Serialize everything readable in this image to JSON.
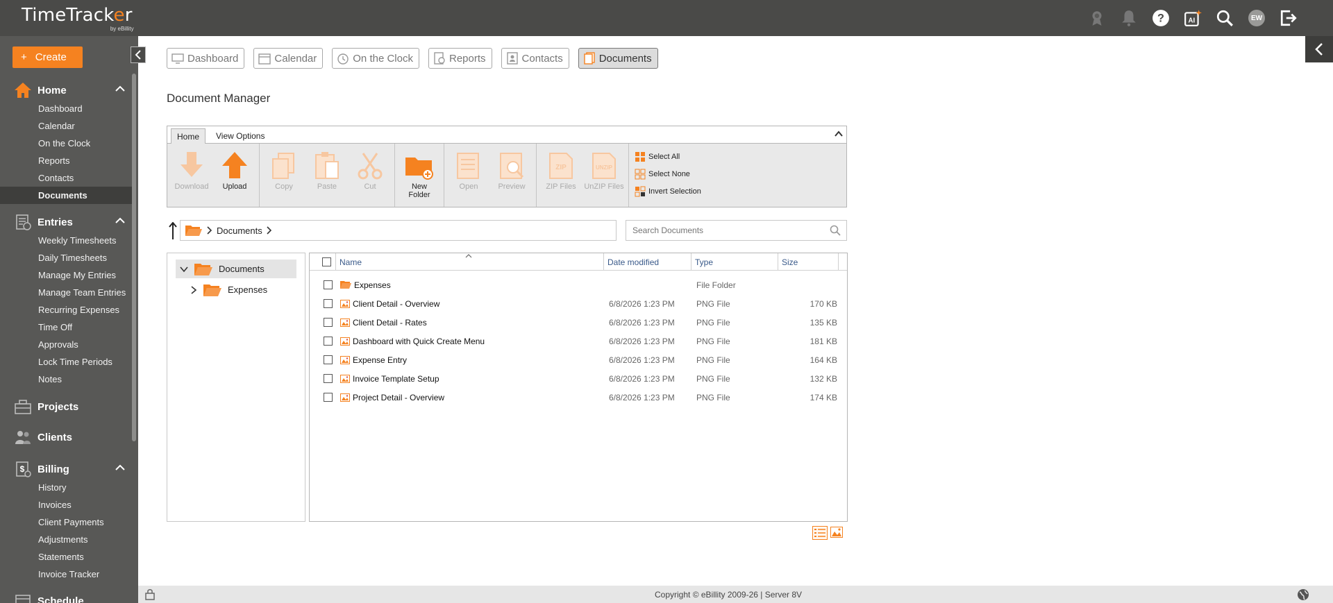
{
  "app": {
    "name": "TimeTrack",
    "name_o": "e",
    "name_end": "r",
    "sub": "by eBillity"
  },
  "topbar": {
    "avatar_initials": "EW",
    "icons": [
      "achievement-icon",
      "bell-icon",
      "help-icon",
      "ai-icon",
      "search-icon",
      "avatar",
      "logout-icon"
    ]
  },
  "sidebar": {
    "create_label": "Create",
    "sections": [
      {
        "title": "Home",
        "items": [
          "Dashboard",
          "Calendar",
          "On the Clock",
          "Reports",
          "Contacts",
          "Documents"
        ]
      },
      {
        "title": "Entries",
        "items": [
          "Weekly Timesheets",
          "Daily Timesheets",
          "Manage My Entries",
          "Manage Team Entries",
          "Recurring Expenses",
          "Time Off",
          "Approvals",
          "Lock Time Periods",
          "Notes"
        ]
      },
      {
        "title": "Projects",
        "items": []
      },
      {
        "title": "Clients",
        "items": []
      },
      {
        "title": "Billing",
        "items": [
          "History",
          "Invoices",
          "Client Payments",
          "Adjustments",
          "Statements",
          "Invoice Tracker"
        ]
      },
      {
        "title": "Schedule",
        "items": []
      }
    ],
    "active_item": "Documents"
  },
  "quick_tabs": [
    "Dashboard",
    "Calendar",
    "On the Clock",
    "Reports",
    "Contacts",
    "Documents"
  ],
  "page_title": "Document Manager",
  "ribbon": {
    "tabs": [
      "Home",
      "View Options"
    ],
    "buttons": {
      "download": "Download",
      "upload": "Upload",
      "copy": "Copy",
      "paste": "Paste",
      "cut": "Cut",
      "new_folder_1": "New",
      "new_folder_2": "Folder",
      "open": "Open",
      "preview": "Preview",
      "zip": "ZIP Files",
      "unzip": "UnZIP Files",
      "zip_glyph": "ZIP",
      "unzip_glyph": "UNZIP"
    },
    "selection": [
      "Select All",
      "Select None",
      "Invert Selection"
    ]
  },
  "path": {
    "current": "Documents"
  },
  "search": {
    "placeholder": "Search Documents"
  },
  "tree": {
    "root": "Documents",
    "child": "Expenses"
  },
  "files": {
    "columns": {
      "name": "Name",
      "date": "Date modified",
      "type": "Type",
      "size": "Size"
    },
    "rows": [
      {
        "name": "Expenses",
        "date": "",
        "type": "File Folder",
        "size": ""
      },
      {
        "name": "Client Detail - Overview",
        "date": "6/8/2026 1:23 PM",
        "type": "PNG File",
        "size": "170 KB"
      },
      {
        "name": "Client Detail - Rates",
        "date": "6/8/2026 1:23 PM",
        "type": "PNG File",
        "size": "135 KB"
      },
      {
        "name": "Dashboard with Quick Create Menu",
        "date": "6/8/2026 1:23 PM",
        "type": "PNG File",
        "size": "181 KB"
      },
      {
        "name": "Expense Entry",
        "date": "6/8/2026 1:23 PM",
        "type": "PNG File",
        "size": "164 KB"
      },
      {
        "name": "Invoice Template Setup",
        "date": "6/8/2026 1:23 PM",
        "type": "PNG File",
        "size": "132 KB"
      },
      {
        "name": "Project Detail - Overview",
        "date": "6/8/2026 1:23 PM",
        "type": "PNG File",
        "size": "174 KB"
      }
    ]
  },
  "footer": {
    "copyright": "Copyright © eBillity 2009-26  |  Server 8V"
  },
  "colors": {
    "accent": "#f58220",
    "topbar": "#4a4a48",
    "sidebar": "#585856"
  }
}
